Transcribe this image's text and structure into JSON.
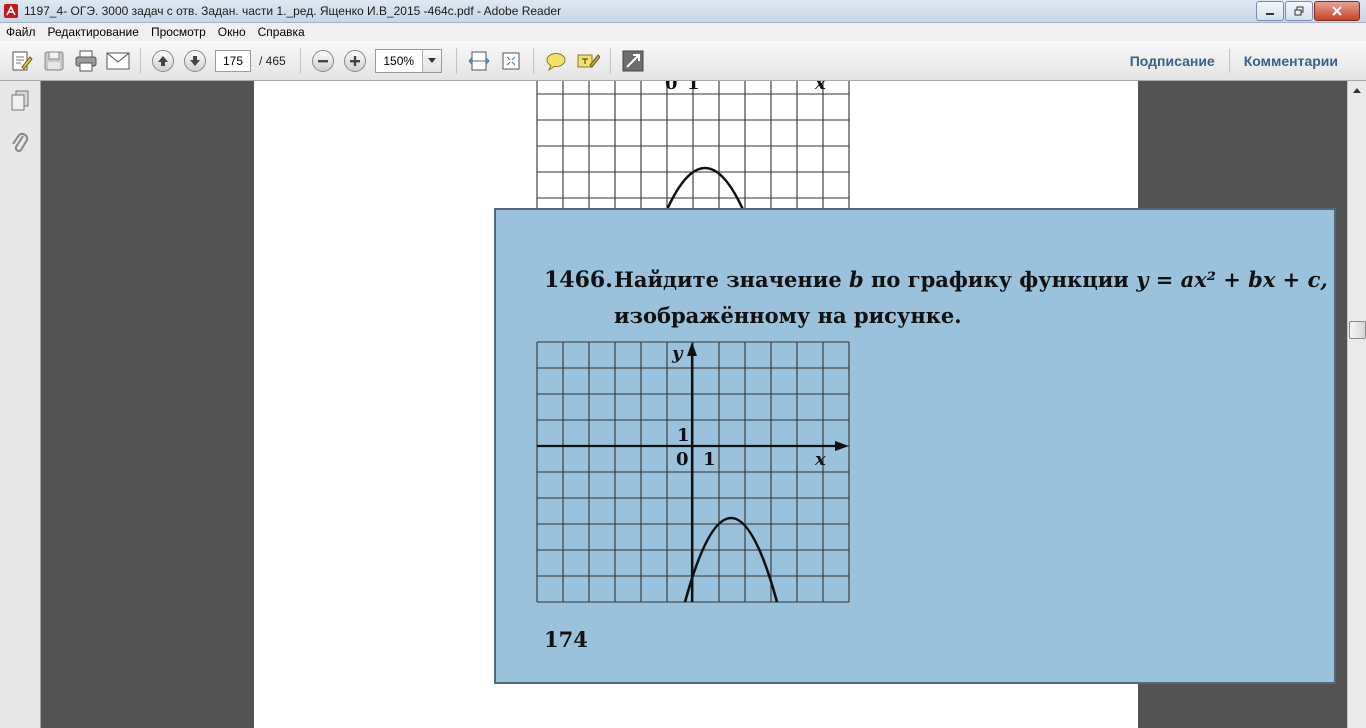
{
  "window": {
    "title": "1197_4- ОГЭ. 3000 задач с отв. Задан. части 1._ред. Ященко И.В_2015 -464с.pdf - Adobe Reader"
  },
  "menu": [
    "Файл",
    "Редактирование",
    "Просмотр",
    "Окно",
    "Справка"
  ],
  "toolbar": {
    "current_page": "175",
    "total_pages": "/ 465",
    "zoom": "150%",
    "sign_label": "Подписание",
    "comments_label": "Комментарии"
  },
  "document": {
    "problem_number": "1466.",
    "problem_line1_prefix": "Найдите значение ",
    "problem_var_b": "b",
    "problem_line1_mid": " по графику функции ",
    "problem_formula": "y = ax² + bx + c,",
    "problem_line2": "изображённому на рисунке.",
    "page_number": "174",
    "graph_labels": {
      "y": "y",
      "x": "x",
      "origin": "0",
      "one_x": "1",
      "one_y": "1"
    }
  },
  "colors": {
    "highlight": "#9bc2dc",
    "highlight_border": "#52697a",
    "link": "#3c5f8c"
  }
}
